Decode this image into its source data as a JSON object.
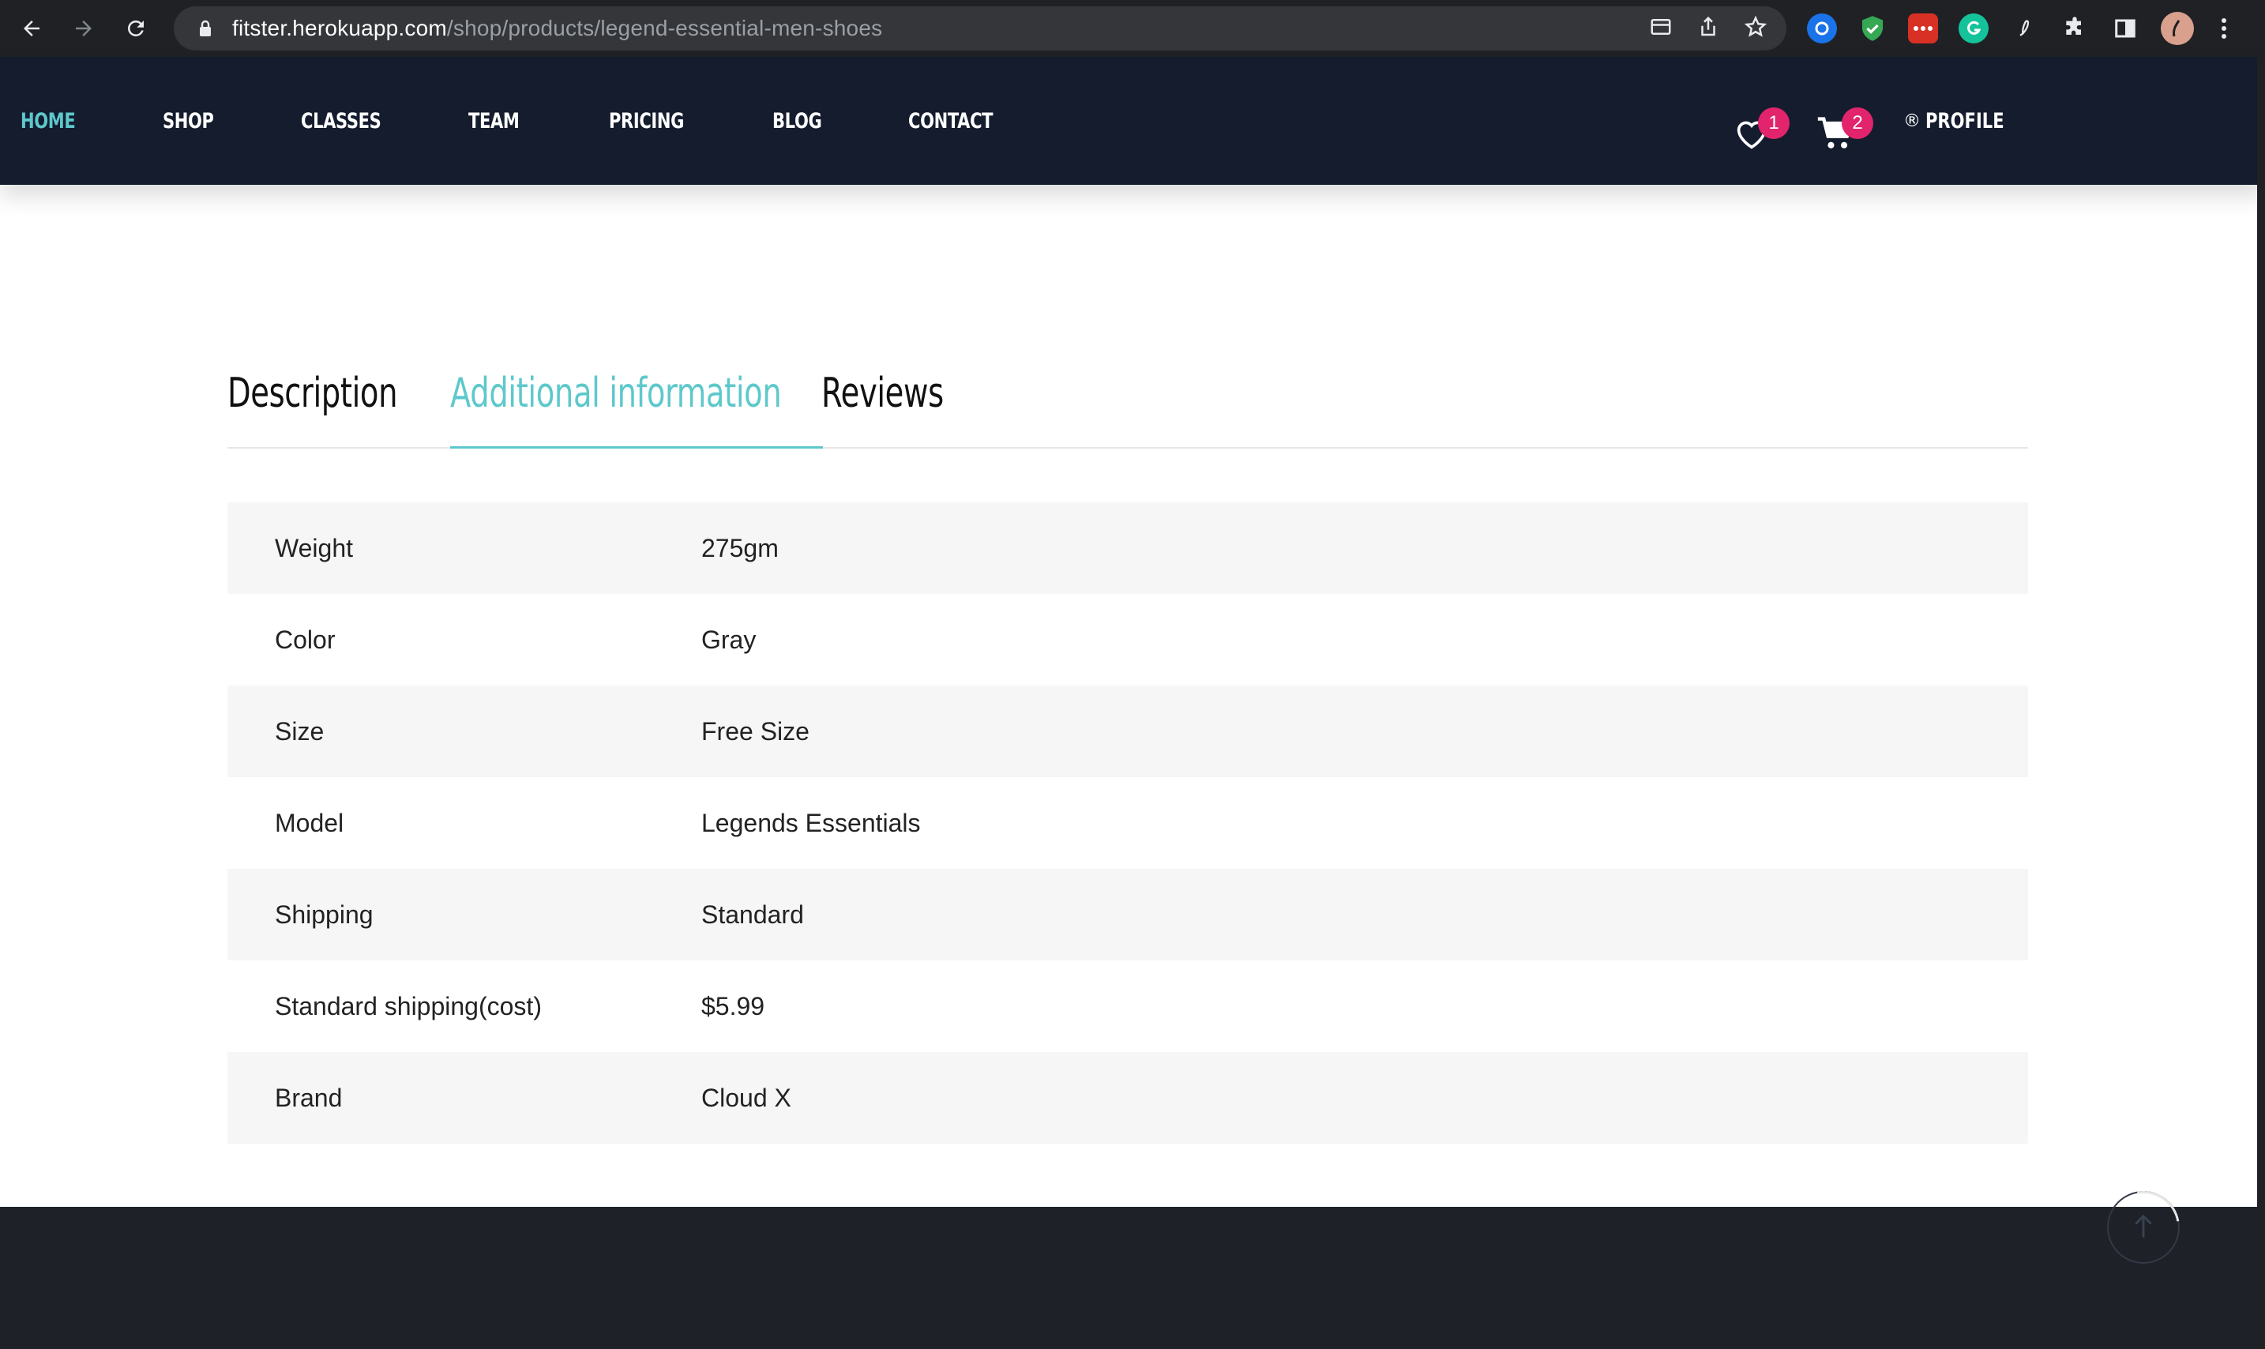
{
  "browser": {
    "url_host": "fitster.herokuapp.com",
    "url_path": "/shop/products/legend-essential-men-shoes"
  },
  "nav": {
    "items": [
      "HOME",
      "SHOP",
      "CLASSES",
      "TEAM",
      "PRICING",
      "BLOG",
      "CONTACT"
    ],
    "active_index": 0,
    "wishlist_count": "1",
    "cart_count": "2",
    "profile_label": "PROFILE",
    "profile_icon": "®"
  },
  "tabs": {
    "items": [
      "Description",
      "Additional information",
      "Reviews"
    ],
    "active_index": 1
  },
  "info": {
    "rows": [
      {
        "key": "Weight",
        "value": "275gm"
      },
      {
        "key": "Color",
        "value": "Gray"
      },
      {
        "key": "Size",
        "value": "Free Size"
      },
      {
        "key": "Model",
        "value": "Legends Essentials"
      },
      {
        "key": "Shipping",
        "value": "Standard"
      },
      {
        "key": "Standard shipping(cost)",
        "value": "$5.99"
      },
      {
        "key": "Brand",
        "value": "Cloud X"
      }
    ]
  },
  "colors": {
    "accent": "#5ec8cb",
    "header_bg": "#141c2e",
    "badge": "#e2246c",
    "footer_bg": "#1e2128"
  },
  "icons": [
    "back-icon",
    "forward-icon",
    "reload-icon",
    "lock-icon",
    "reader-mode-icon",
    "share-icon",
    "star-icon",
    "extension-icon",
    "puzzle-icon",
    "sidebar-icon",
    "avatar",
    "menu-dots-icon",
    "heart-icon",
    "cart-icon",
    "arrow-up-icon"
  ]
}
